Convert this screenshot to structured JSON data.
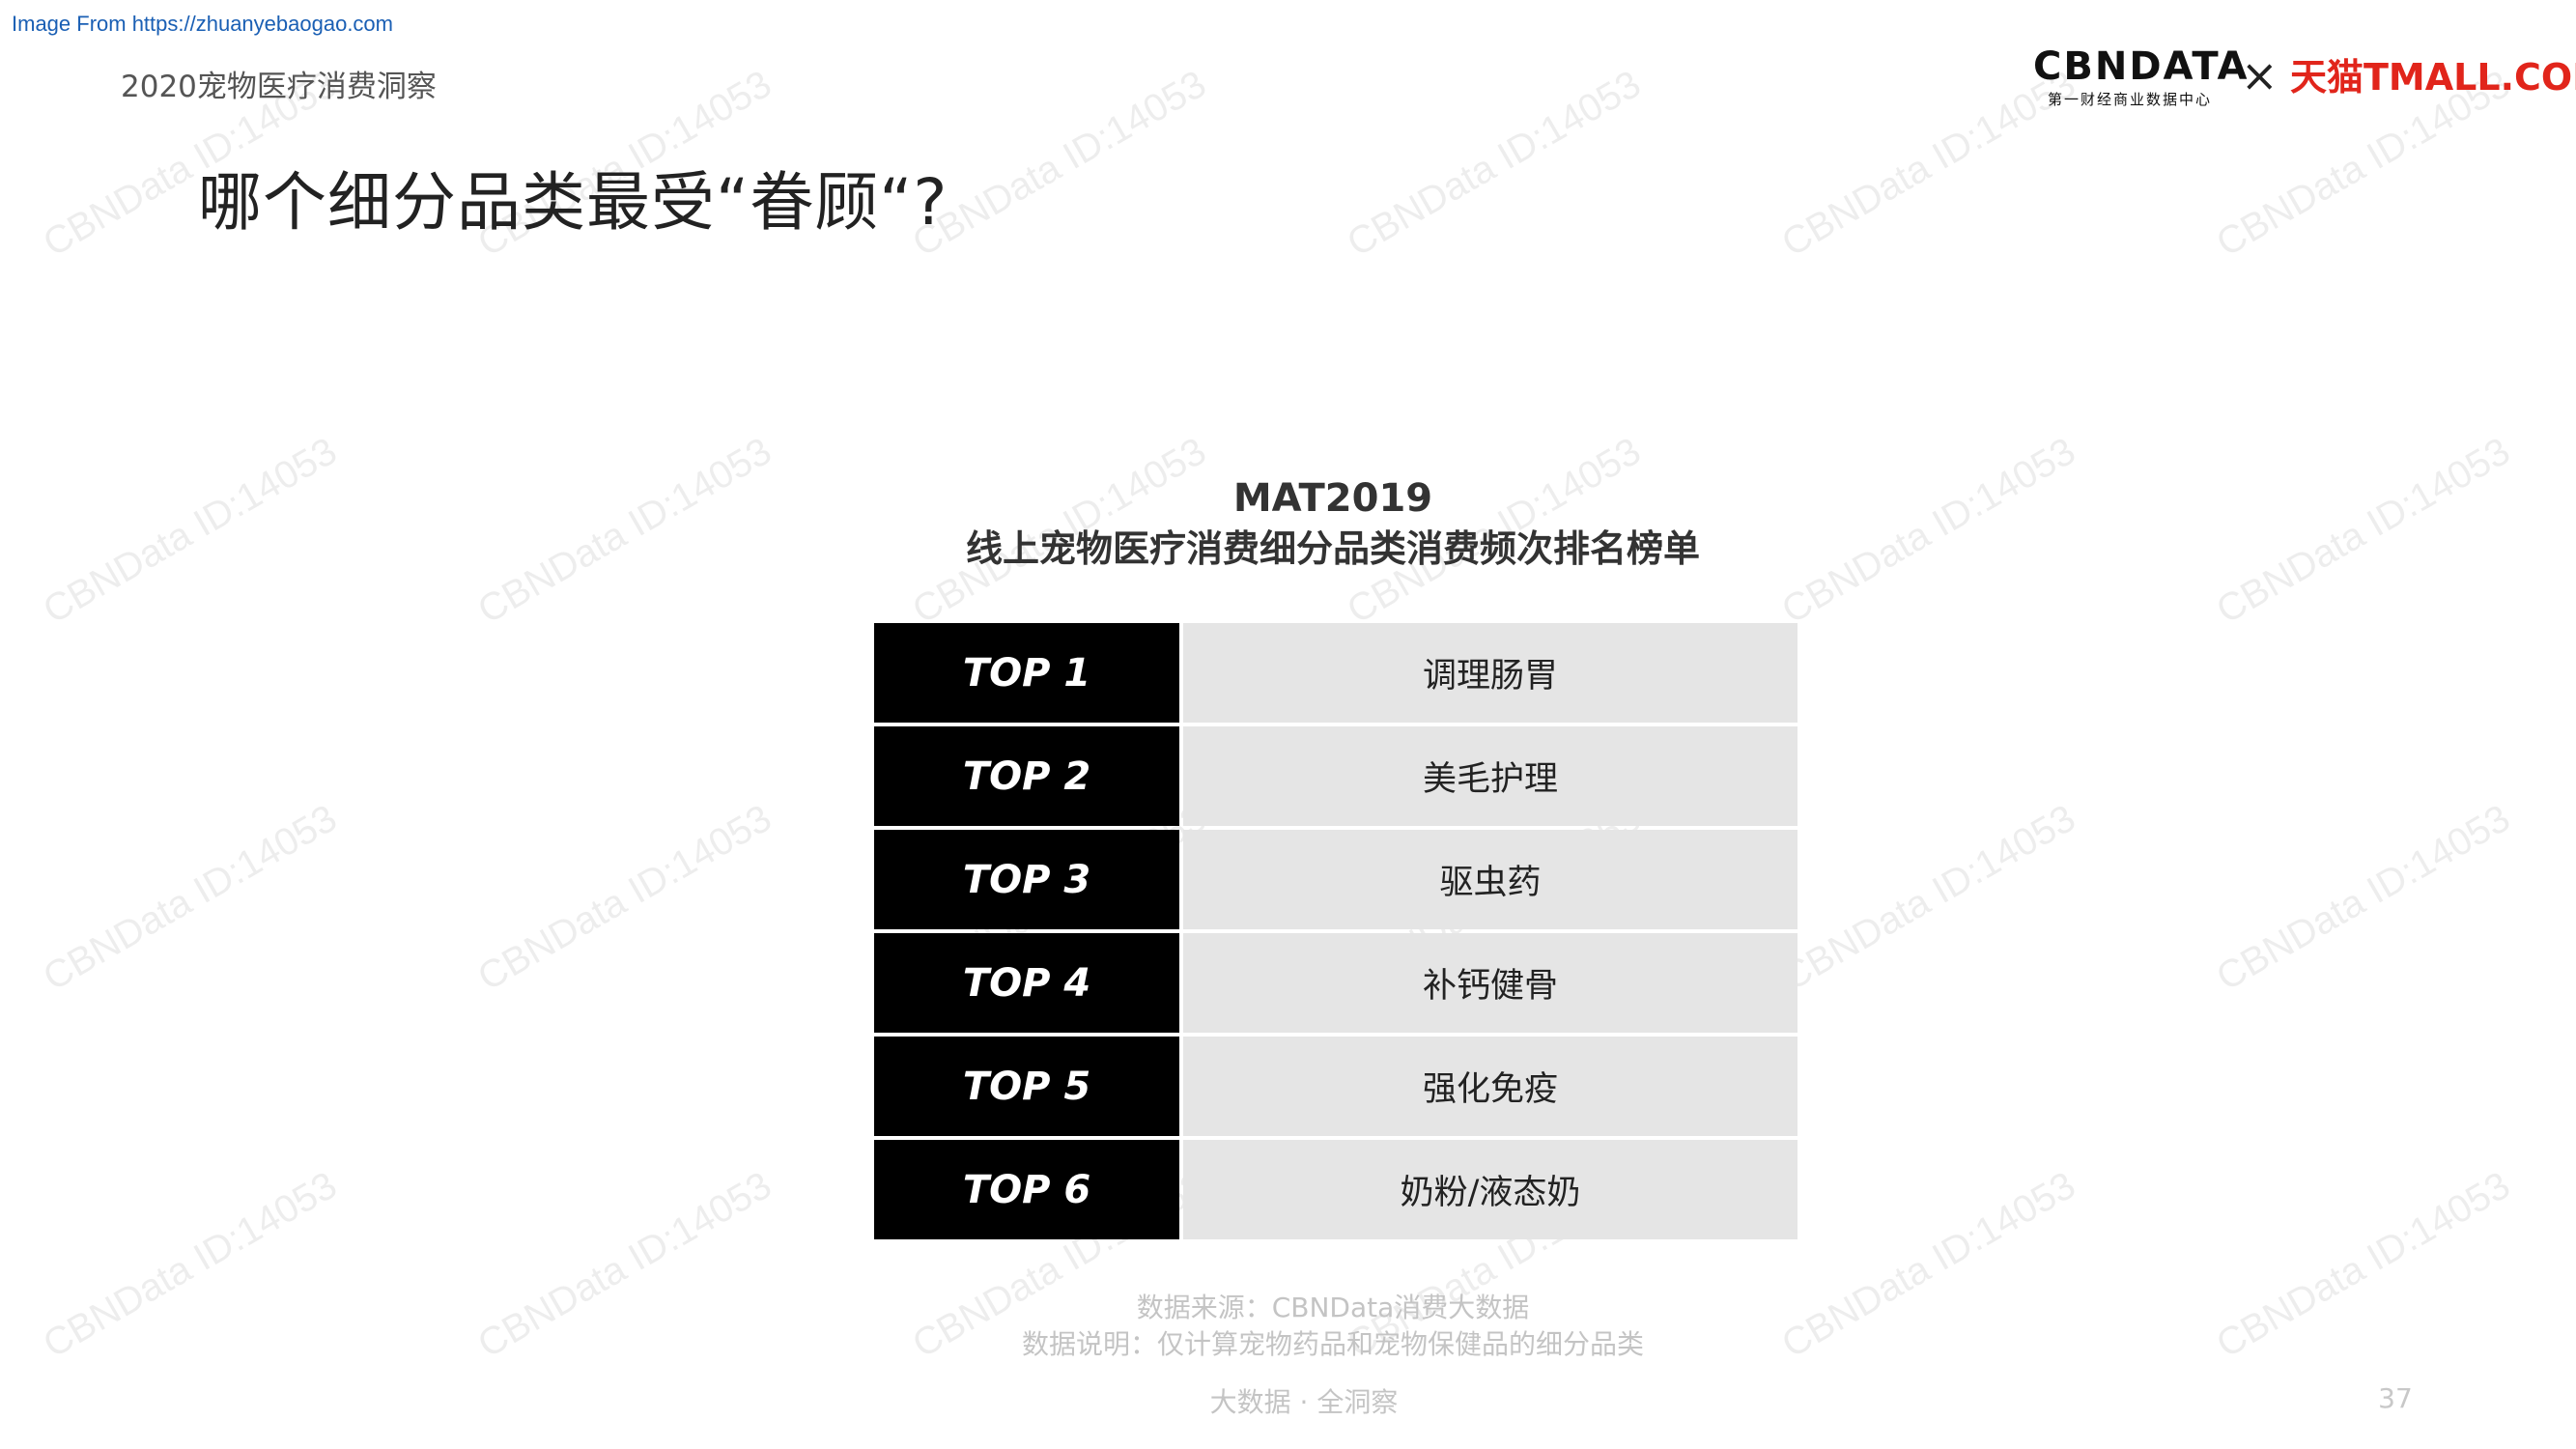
{
  "source_link": "Image From https://zhuanyebaogao.com",
  "report_title": "2020宠物医疗消费洞察",
  "heading": "哪个细分品类最受“眷顾“?",
  "logos": {
    "cbn_main": "CBNDATA",
    "cbn_sub": "第一财经商业数据中心",
    "times": "×",
    "tmall": "天猫TMALL.COM"
  },
  "chart": {
    "title_line1": "MAT2019",
    "title_line2": "线上宠物医疗消费细分品类消费频次排名榜单",
    "rows": [
      {
        "rank": "TOP 1",
        "category": "调理肠胃"
      },
      {
        "rank": "TOP 2",
        "category": "美毛护理"
      },
      {
        "rank": "TOP 3",
        "category": "驱虫药"
      },
      {
        "rank": "TOP 4",
        "category": "补钙健骨"
      },
      {
        "rank": "TOP 5",
        "category": "强化免疫"
      },
      {
        "rank": "TOP 6",
        "category": "奶粉/液态奶"
      }
    ]
  },
  "notes": {
    "source": "数据来源：CBNData消费大数据",
    "explanation": "数据说明：仅计算宠物药品和宠物保健品的细分品类"
  },
  "footer": {
    "tagline": "大数据 · 全洞察",
    "page_number": "37"
  },
  "watermark_text": "CBNData ID:14053",
  "colors": {
    "rank_bg": "#000000",
    "category_bg": "#e5e5e5",
    "tmall_red": "#e1251b",
    "link_blue": "#1a5fb4"
  }
}
